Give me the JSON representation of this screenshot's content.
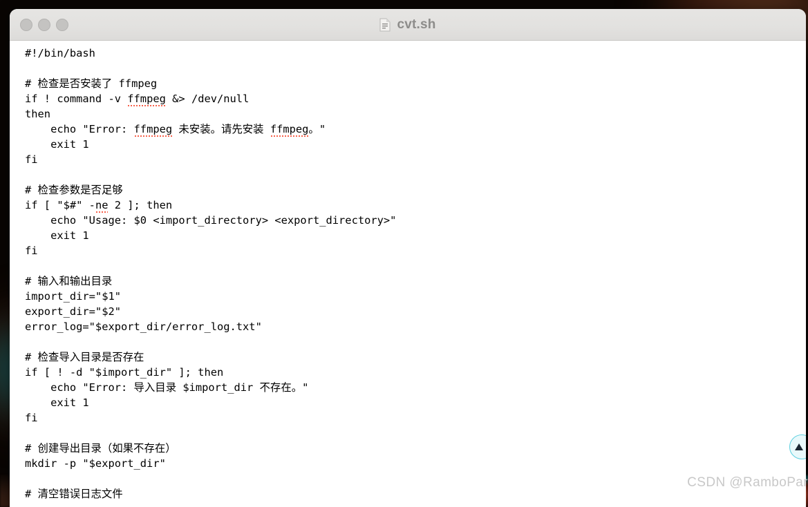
{
  "window": {
    "title": "cvt.sh",
    "file_icon": "document-icon",
    "traffic_lights": [
      "close-button",
      "minimize-button",
      "zoom-button"
    ]
  },
  "code": {
    "language": "bash",
    "lines": [
      {
        "text": "#!/bin/bash"
      },
      {
        "text": ""
      },
      {
        "text": "# 检查是否安装了 ffmpeg"
      },
      {
        "pre": "if ! command -v ",
        "bad": "ffmpeg",
        "post": " &> /dev/null"
      },
      {
        "text": "then"
      },
      {
        "pre": "    echo \"Error: ",
        "bad": "ffmpeg",
        "mid": " 未安装。请先安装 ",
        "bad2": "ffmpeg",
        "post": "。\""
      },
      {
        "text": "    exit 1"
      },
      {
        "text": "fi"
      },
      {
        "text": ""
      },
      {
        "text": "# 检查参数是否足够"
      },
      {
        "pre": "if [ \"$#\" -",
        "bad": "ne",
        "post": " 2 ]; then"
      },
      {
        "text": "    echo \"Usage: $0 <import_directory> <export_directory>\""
      },
      {
        "text": "    exit 1"
      },
      {
        "text": "fi"
      },
      {
        "text": ""
      },
      {
        "text": "# 输入和输出目录"
      },
      {
        "text": "import_dir=\"$1\""
      },
      {
        "text": "export_dir=\"$2\""
      },
      {
        "text": "error_log=\"$export_dir/error_log.txt\""
      },
      {
        "text": ""
      },
      {
        "text": "# 检查导入目录是否存在"
      },
      {
        "text": "if [ ! -d \"$import_dir\" ]; then"
      },
      {
        "text": "    echo \"Error: 导入目录 $import_dir 不存在。\""
      },
      {
        "text": "    exit 1"
      },
      {
        "text": "fi"
      },
      {
        "text": ""
      },
      {
        "text": "# 创建导出目录（如果不存在）"
      },
      {
        "text": "mkdir -p \"$export_dir\""
      },
      {
        "text": ""
      },
      {
        "text": "# 清空错误日志文件"
      }
    ]
  },
  "badge": {
    "icon": "triangle-up-icon"
  },
  "watermark": {
    "text": "CSDN @RamboPar"
  },
  "colors": {
    "titlebar": "#e3e2e0",
    "title_text": "#8d8c8a",
    "code_text": "#000000",
    "editor_bg": "#ffffff",
    "spellcheck_underline": "#f8604a",
    "badge_border": "#5ed0e0",
    "badge_fill": "#e9f9fb"
  }
}
